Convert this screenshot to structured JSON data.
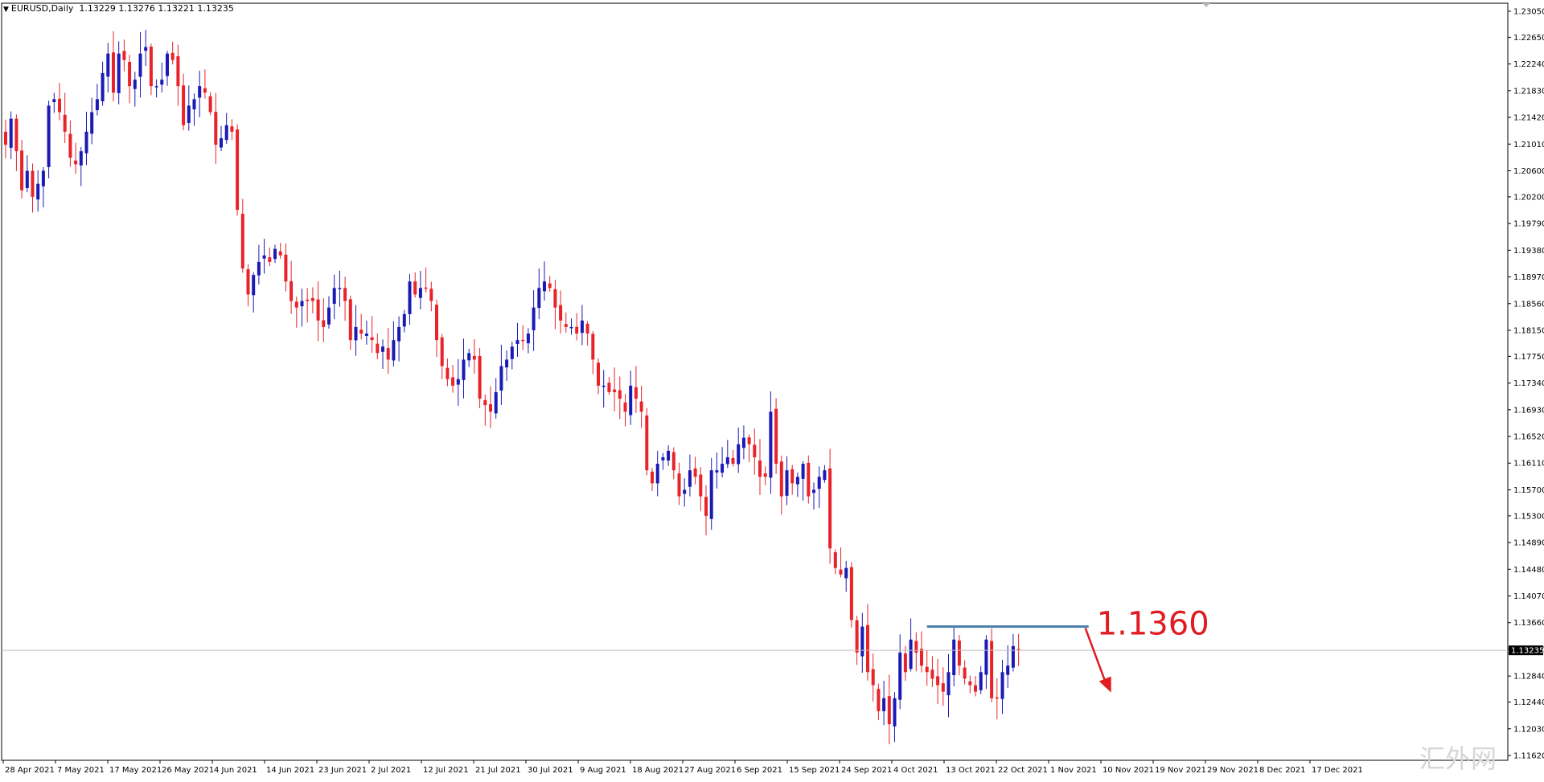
{
  "header": {
    "symbol_timeframe": "EURUSD,Daily",
    "ohlc": "1.13229 1.13276 1.13221 1.13235"
  },
  "colors": {
    "bull": "#1a1ab4",
    "bear": "#e8232a",
    "hline": "#4a7ea8",
    "annotation": "#e01b22",
    "grid": "#000000",
    "background": "#ffffff"
  },
  "chart_data": {
    "type": "candlestick",
    "symbol": "EURUSD",
    "timeframe": "Daily",
    "ylim": [
      1.1165,
      1.232
    ],
    "price_ticks": [
      "1.23050",
      "1.22650",
      "1.22240",
      "1.21830",
      "1.21420",
      "1.21010",
      "1.20600",
      "1.20200",
      "1.19790",
      "1.19380",
      "1.18970",
      "1.18560",
      "1.18150",
      "1.17750",
      "1.17340",
      "1.16930",
      "1.16520",
      "1.16110",
      "1.15700",
      "1.15300",
      "1.14890",
      "1.14480",
      "1.14070",
      "1.13660",
      "1.13250",
      "1.12840",
      "1.12440",
      "1.12030",
      "1.11620"
    ],
    "current_price": "1.13235",
    "date_labels": [
      "28 Apr 2021",
      "7 May 2021",
      "17 May 2021",
      "26 May 2021",
      "4 Jun 2021",
      "14 Jun 2021",
      "23 Jun 2021",
      "2 Jul 2021",
      "12 Jul 2021",
      "21 Jul 2021",
      "30 Jul 2021",
      "9 Aug 2021",
      "18 Aug 2021",
      "27 Aug 2021",
      "6 Sep 2021",
      "15 Sep 2021",
      "24 Sep 2021",
      "4 Oct 2021",
      "13 Oct 2021",
      "22 Oct 2021",
      "1 Nov 2021",
      "10 Nov 2021",
      "19 Nov 2021",
      "29 Nov 2021",
      "8 Dec 2021",
      "17 Dec 2021"
    ],
    "closes": [
      1.21,
      1.214,
      1.209,
      1.203,
      1.206,
      1.202,
      1.204,
      1.206,
      1.216,
      1.217,
      1.215,
      1.212,
      1.208,
      1.207,
      1.209,
      1.212,
      1.215,
      1.217,
      1.221,
      1.224,
      1.218,
      1.224,
      1.223,
      1.219,
      1.22,
      1.224,
      1.225,
      1.219,
      1.219,
      1.22,
      1.224,
      1.223,
      1.219,
      1.213,
      1.216,
      1.217,
      1.219,
      1.218,
      1.215,
      1.21,
      1.211,
      1.213,
      1.212,
      1.2,
      1.191,
      1.187,
      1.19,
      1.192,
      1.193,
      1.192,
      1.194,
      1.193,
      1.189,
      1.186,
      1.185,
      1.186,
      1.186,
      1.186,
      1.183,
      1.182,
      1.185,
      1.188,
      1.188,
      1.186,
      1.18,
      1.182,
      1.181,
      1.181,
      1.18,
      1.178,
      1.179,
      1.177,
      1.18,
      1.182,
      1.184,
      1.189,
      1.187,
      1.188,
      1.188,
      1.186,
      1.18,
      1.176,
      1.174,
      1.173,
      1.174,
      1.177,
      1.178,
      1.177,
      1.171,
      1.17,
      1.169,
      1.172,
      1.176,
      1.177,
      1.179,
      1.18,
      1.18,
      1.181,
      1.185,
      1.188,
      1.189,
      1.188,
      1.185,
      1.183,
      1.182,
      1.182,
      1.181,
      1.183,
      1.181,
      1.177,
      1.173,
      1.173,
      1.172,
      1.172,
      1.171,
      1.169,
      1.173,
      1.171,
      1.169,
      1.16,
      1.158,
      1.161,
      1.162,
      1.163,
      1.16,
      1.156,
      1.157,
      1.16,
      1.159,
      1.156,
      1.153,
      1.16,
      1.16,
      1.161,
      1.162,
      1.161,
      1.164,
      1.165,
      1.164,
      1.162,
      1.159,
      1.159,
      1.169,
      1.161,
      1.156,
      1.16,
      1.158,
      1.159,
      1.161,
      1.156,
      1.157,
      1.159,
      1.16,
      1.148,
      1.145,
      1.144,
      1.145,
      1.137,
      1.132,
      1.136,
      1.129,
      1.127,
      1.123,
      1.125,
      1.121,
      1.125,
      1.132,
      1.129,
      1.134,
      1.132,
      1.13,
      1.129,
      1.128,
      1.127,
      1.126,
      1.129,
      1.134,
      1.13,
      1.128,
      1.127,
      1.126,
      1.129,
      1.134,
      1.125,
      1.125,
      1.129,
      1.13,
      1.133,
      1.1323
    ]
  },
  "annotations": {
    "level_label": "1.1360",
    "level_value": 1.136
  },
  "watermark": {
    "text": "汇外网"
  }
}
